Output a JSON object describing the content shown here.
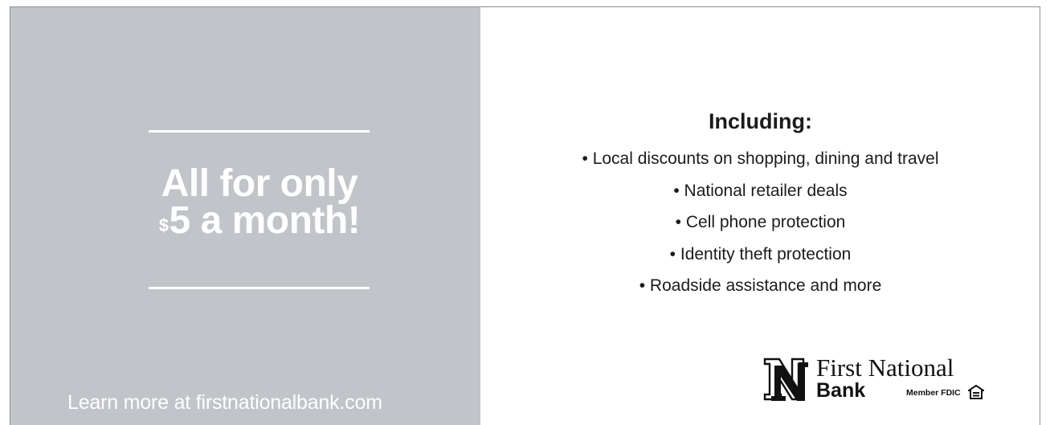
{
  "promo": {
    "headline_line1": "All for only",
    "price_symbol": "$",
    "headline_line2": "5 a month!",
    "learn_more": "Learn more at firstnationalbank.com"
  },
  "benefits": {
    "heading": "Including:",
    "items": [
      "Local discounts on shopping, dining and travel",
      "National retailer deals",
      "Cell phone protection",
      "Identity theft protection",
      "Roadside assistance and more"
    ]
  },
  "brand": {
    "name_line1": "First National",
    "name_line2": "Bank",
    "fdic": "Member FDIC",
    "logo_icon": "fnb-n-mark-icon",
    "housing_icon": "equal-housing-lender-icon"
  },
  "colors": {
    "panel": "#c1c4c8",
    "text_dark": "#1b1b1d",
    "text_light": "#ffffff"
  }
}
